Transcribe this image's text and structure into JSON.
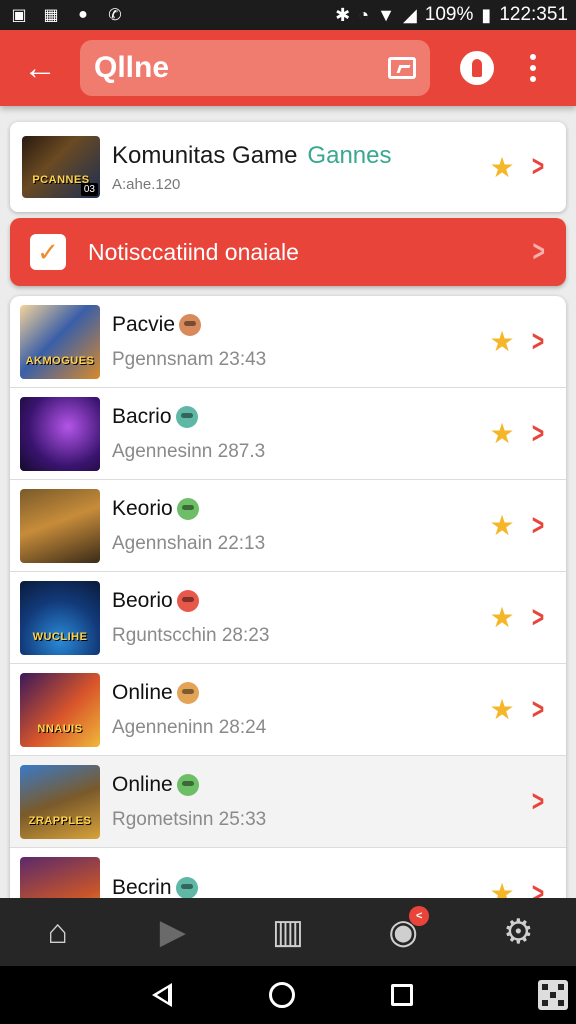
{
  "status_bar": {
    "left_icons": [
      "image-icon",
      "gallery-icon",
      "messenger-icon",
      "phone-icon"
    ],
    "battery": "109%",
    "time": "122:351"
  },
  "app_bar": {
    "title": "Qllne"
  },
  "community": {
    "title": "Komunitas Game",
    "accent": "Gannes",
    "subtitle": "A:ahe.120",
    "thumb_text": "PCANNES",
    "thumb_badge": "03"
  },
  "notification": {
    "label": "Notisccatiind onaiale"
  },
  "games": [
    {
      "title": "Pacvie",
      "subtitle": "Pgennsnam 23:43",
      "thumb_text": "AKMOGUES",
      "avatar_color": "#d98a5c"
    },
    {
      "title": "Bacrio",
      "subtitle": "Agennesinn 287.3",
      "thumb_text": "",
      "avatar_color": "#5fb8a6"
    },
    {
      "title": "Keorio",
      "subtitle": "Agennshain 22:13",
      "thumb_text": "",
      "avatar_color": "#6cbf66"
    },
    {
      "title": "Beorio",
      "subtitle": "Rguntscchin 28:23",
      "thumb_text": "WUCLIHE",
      "avatar_color": "#e8584a"
    },
    {
      "title": "Online",
      "subtitle": "Agenneninn 28:24",
      "thumb_text": "NNAUIS",
      "avatar_color": "#e3a457"
    },
    {
      "title": "Online",
      "subtitle": "Rgometsinn 25:33",
      "thumb_text": "ZRAPPLES",
      "avatar_color": "#6cbf66"
    },
    {
      "title": "Becrin",
      "subtitle": "",
      "thumb_text": "",
      "avatar_color": "#5fb8a6"
    }
  ],
  "bottom_nav": [
    {
      "name": "home",
      "icon": "home-icon"
    },
    {
      "name": "play",
      "icon": "play-icon"
    },
    {
      "name": "library",
      "icon": "library-icon"
    },
    {
      "name": "messages",
      "icon": "chat-icon",
      "badge": "<"
    },
    {
      "name": "settings",
      "icon": "gear-icon"
    }
  ],
  "colors": {
    "primary": "#e9443a",
    "accent": "#3aa88f",
    "star": "#f5b72a"
  }
}
